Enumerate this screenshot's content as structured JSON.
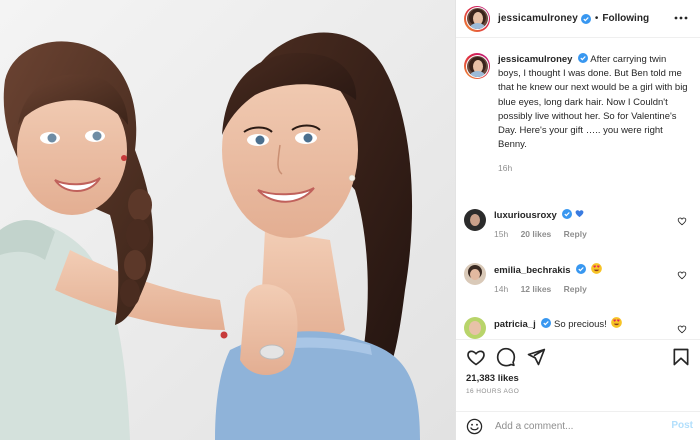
{
  "header": {
    "username": "jessicamulroney",
    "separator": "•",
    "follow_status": "Following"
  },
  "caption": {
    "username": "jessicamulroney",
    "text": "After carrying twin boys, I thought I was done. But Ben told me that he knew our next would be a girl with big blue eyes, long dark hair. Now I Couldn't possibly live without her. So for Valentine's Day. Here's your gift ….. you were right Benny.",
    "time": "16h"
  },
  "comments": [
    {
      "username": "luxuriousroxy",
      "text": "",
      "emoji": "blue-heart",
      "time": "15h",
      "likes": "20 likes",
      "reply": "Reply"
    },
    {
      "username": "emilia_bechrakis",
      "text": "",
      "emoji": "heart-eyes",
      "time": "14h",
      "likes": "12 likes",
      "reply": "Reply"
    },
    {
      "username": "patricia_j",
      "text": "So precious!",
      "emoji": "heart-eyes",
      "time": "",
      "likes": "",
      "reply": ""
    }
  ],
  "actions": {
    "icons": [
      "heart-icon",
      "comment-icon",
      "share-icon",
      "bookmark-icon"
    ]
  },
  "likes_text": "21,383 likes",
  "timestamp": "16 HOURS AGO",
  "add_comment": {
    "placeholder": "Add a comment...",
    "post_label": "Post"
  },
  "colors": {
    "verified": "#3897f0",
    "post_button": "#b2dffc",
    "secondary_text": "#8e8e8e",
    "dress": "#8fb3d9"
  }
}
